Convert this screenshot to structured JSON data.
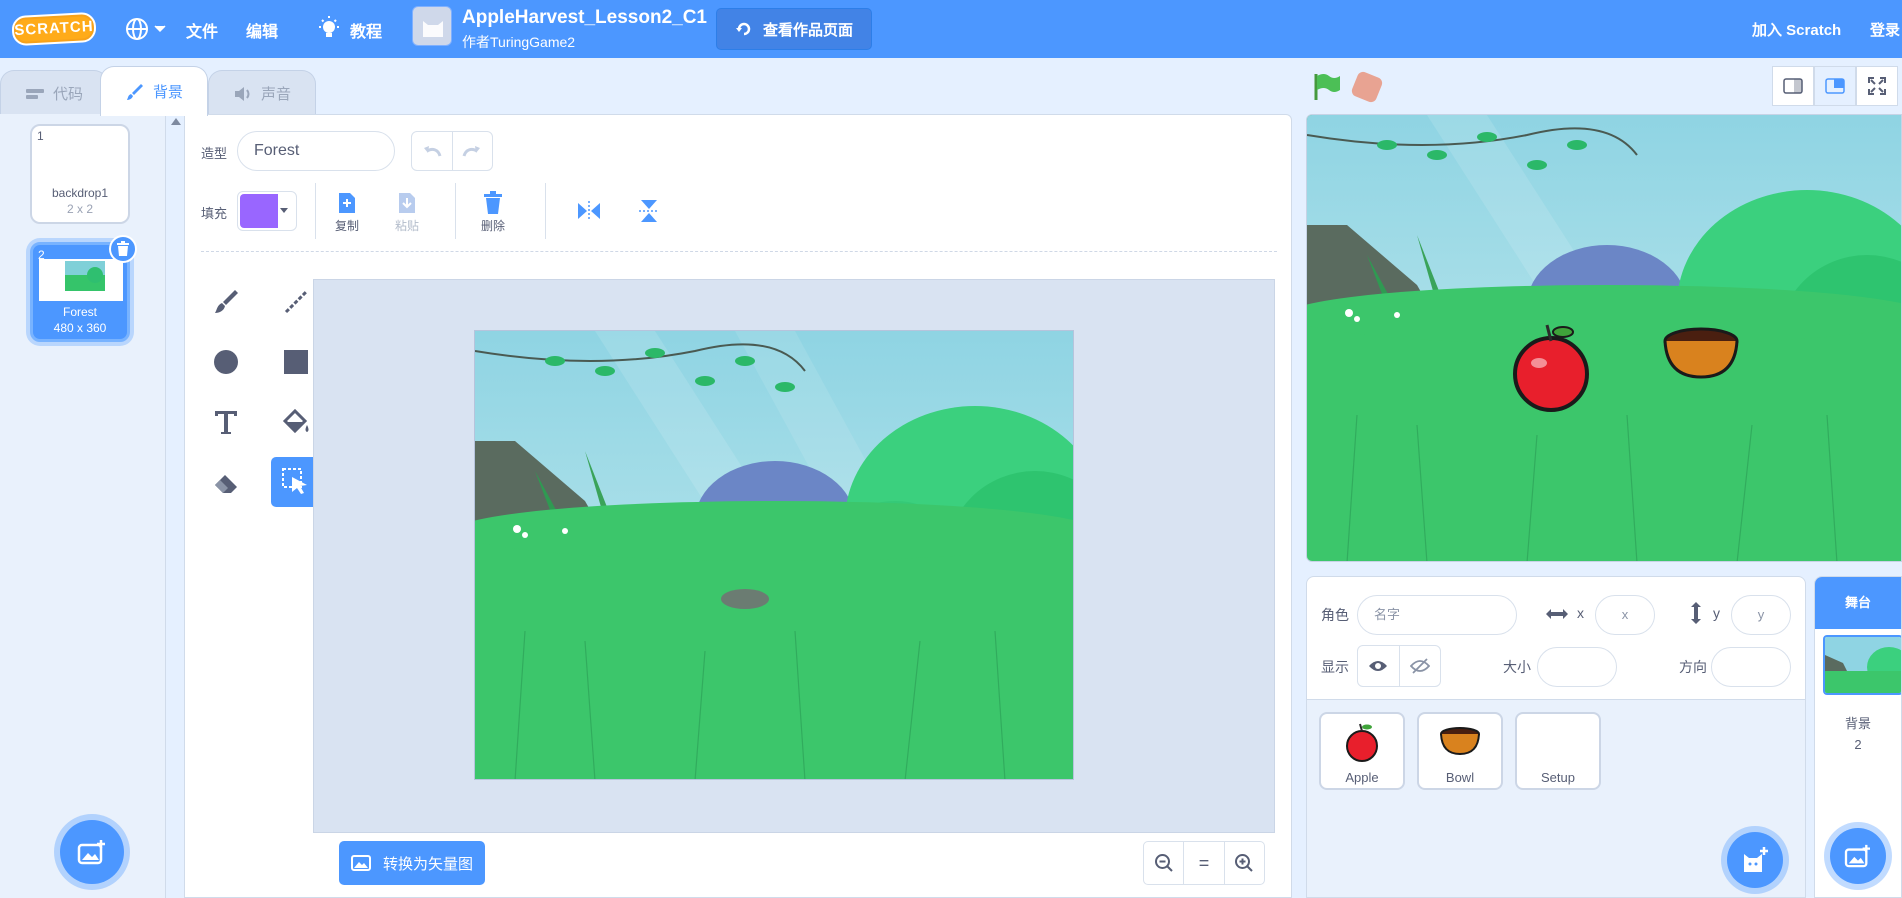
{
  "menubar": {
    "logo_text": "SCRATCH",
    "file": "文件",
    "edit": "编辑",
    "tutorials": "教程",
    "project_title": "AppleHarvest_Lesson2_C1",
    "author": "作者TuringGame2",
    "see_project_page": "查看作品页面",
    "join": "加入 Scratch",
    "sign_in": "登录"
  },
  "tabs": [
    {
      "label": "代码",
      "icon": "code-icon"
    },
    {
      "label": "背景",
      "icon": "brush-icon",
      "active": true
    },
    {
      "label": "声音",
      "icon": "speaker-icon"
    }
  ],
  "costumes": [
    {
      "num": "1",
      "name": "backdrop1",
      "size": "2 x 2"
    },
    {
      "num": "2",
      "name": "Forest",
      "size": "480 x 360",
      "selected": true
    }
  ],
  "paint": {
    "costume_label": "造型",
    "costume_name": "Forest",
    "fill_label": "填充",
    "fill_color": "#9966ff",
    "copy": "复制",
    "paste": "粘贴",
    "delete": "删除",
    "convert_vector": "转换为矢量图",
    "zoom_reset": "="
  },
  "sprite_info": {
    "sprite_label": "角色",
    "name_placeholder": "名字",
    "x_label": "x",
    "x_placeholder": "x",
    "y_label": "y",
    "y_placeholder": "y",
    "show_label": "显示",
    "size_label": "大小",
    "direction_label": "方向"
  },
  "sprites": [
    {
      "name": "Apple",
      "icon": "apple-icon"
    },
    {
      "name": "Bowl",
      "icon": "bowl-icon"
    },
    {
      "name": "Setup",
      "icon": ""
    }
  ],
  "stage_selector": {
    "title": "舞台",
    "backdrops_label": "背景",
    "backdrop_count": "2"
  },
  "colors": {
    "accent": "#4c97ff",
    "menubar": "#4c97ff",
    "logo": "#ffab19",
    "fill": "#9966ff"
  }
}
